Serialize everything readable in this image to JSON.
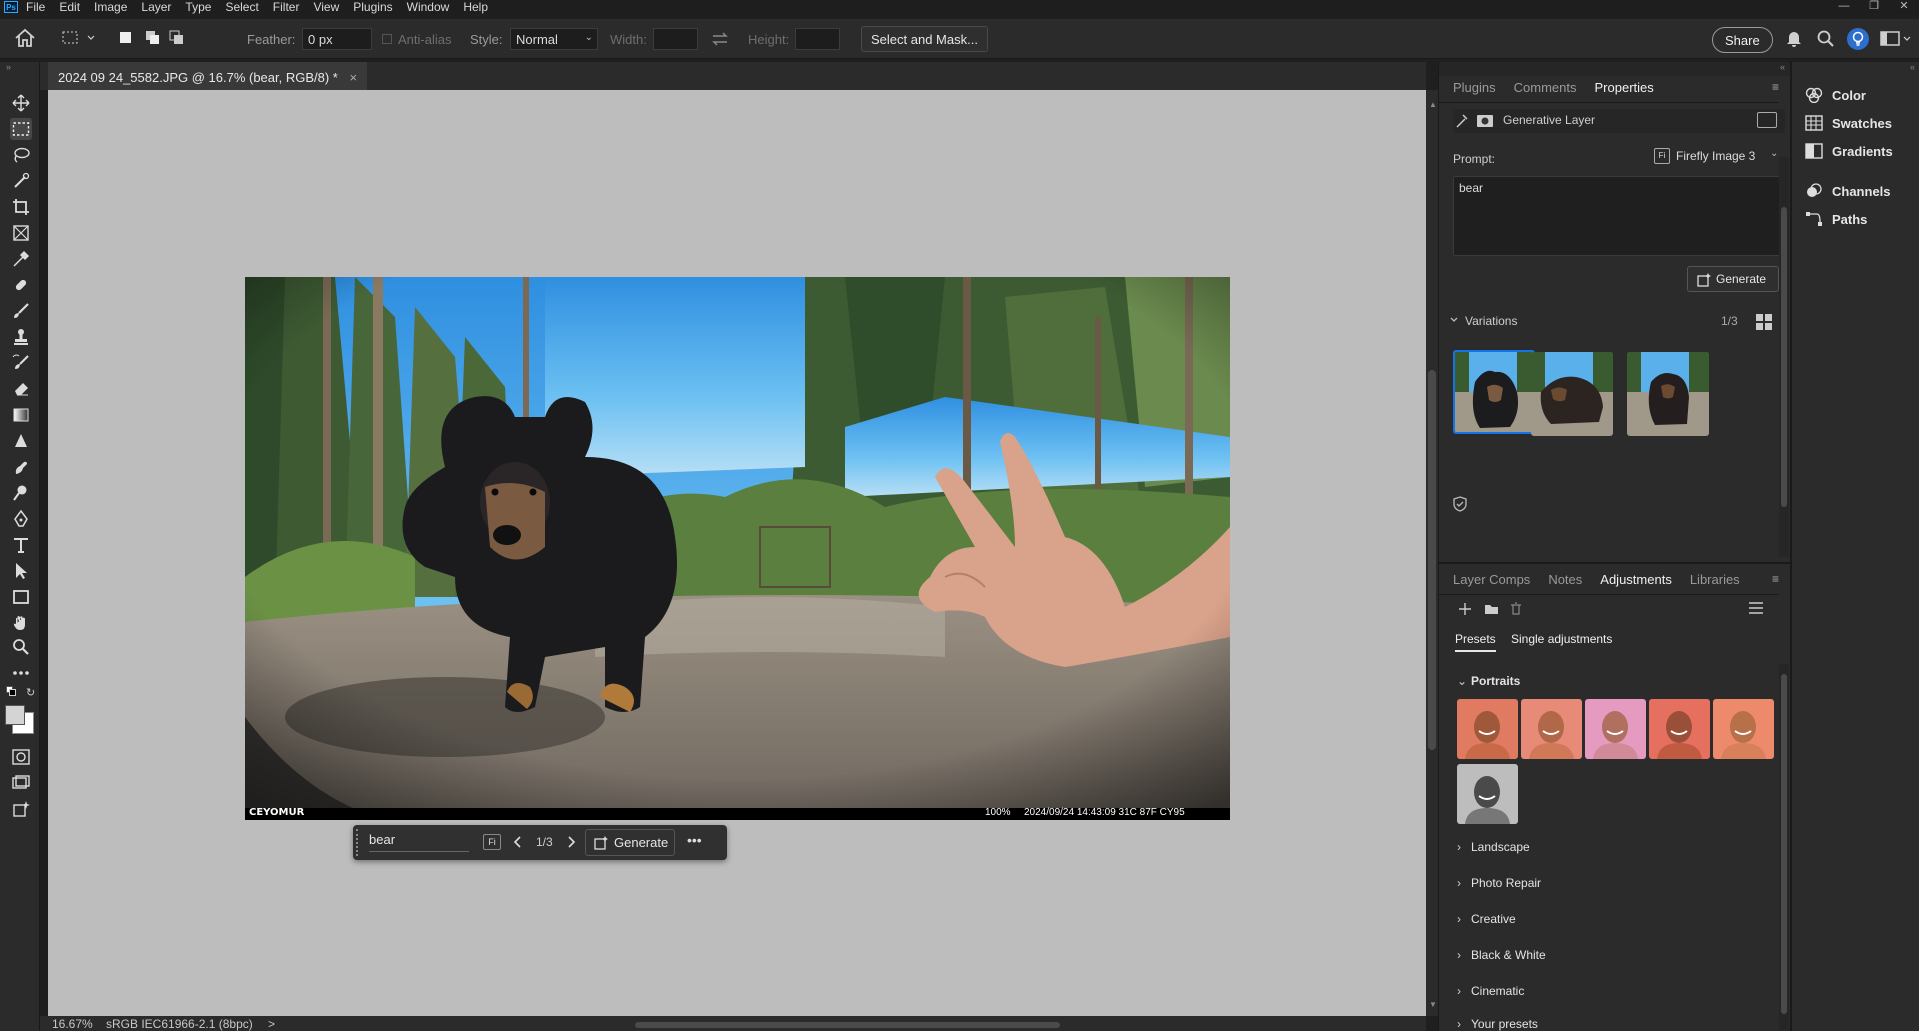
{
  "app": {
    "logo": "Ps",
    "menus": [
      "File",
      "Edit",
      "Image",
      "Layer",
      "Type",
      "Select",
      "Filter",
      "View",
      "Plugins",
      "Window",
      "Help"
    ]
  },
  "options": {
    "feather_label": "Feather:",
    "feather_value": "0 px",
    "antialias_label": "Anti-alias",
    "style_label": "Style:",
    "style_value": "Normal",
    "width_label": "Width:",
    "height_label": "Height:",
    "select_mask": "Select and Mask...",
    "share": "Share"
  },
  "document": {
    "tab_title": "2024 09 24_5582.JPG @ 16.7% (bear, RGB/8) *",
    "close": "×"
  },
  "photo": {
    "camera_brand": "CEYOMUR",
    "battery": "100%",
    "stamp": "2024/09/24 14:43:09  31C 87F CY95"
  },
  "contextbar": {
    "prompt": "bear",
    "firefly_badge": "Fi",
    "counter": "1/3",
    "generate": "Generate",
    "more": "•••"
  },
  "status": {
    "zoom": "16.67%",
    "profile": "sRGB IEC61966-2.1 (8bpc)",
    "arrow": ">"
  },
  "properties_panel": {
    "tabs": [
      "Plugins",
      "Comments",
      "Properties"
    ],
    "active_tab": "Properties",
    "layer_type": "Generative Layer",
    "prompt_label": "Prompt:",
    "model": "Firefly Image 3",
    "prompt_text": "bear",
    "generate": "Generate",
    "variations_label": "Variations",
    "variations_count": "1/3"
  },
  "adjustments_panel": {
    "tabs": [
      "Layer Comps",
      "Notes",
      "Adjustments",
      "Libraries"
    ],
    "active_tab": "Adjustments",
    "subtabs": [
      "Presets",
      "Single adjustments"
    ],
    "expanded_group": "Portraits",
    "groups": [
      "Landscape",
      "Photo Repair",
      "Creative",
      "Black & White",
      "Cinematic",
      "Your presets"
    ]
  },
  "dock": {
    "items": [
      "Color",
      "Swatches",
      "Gradients",
      "Channels",
      "Paths"
    ]
  },
  "colors": {
    "accent": "#1473e6",
    "panel_bg": "#2b2b2b",
    "canvas_bg": "#bdbdbd",
    "sky": "#3aa0e8"
  }
}
